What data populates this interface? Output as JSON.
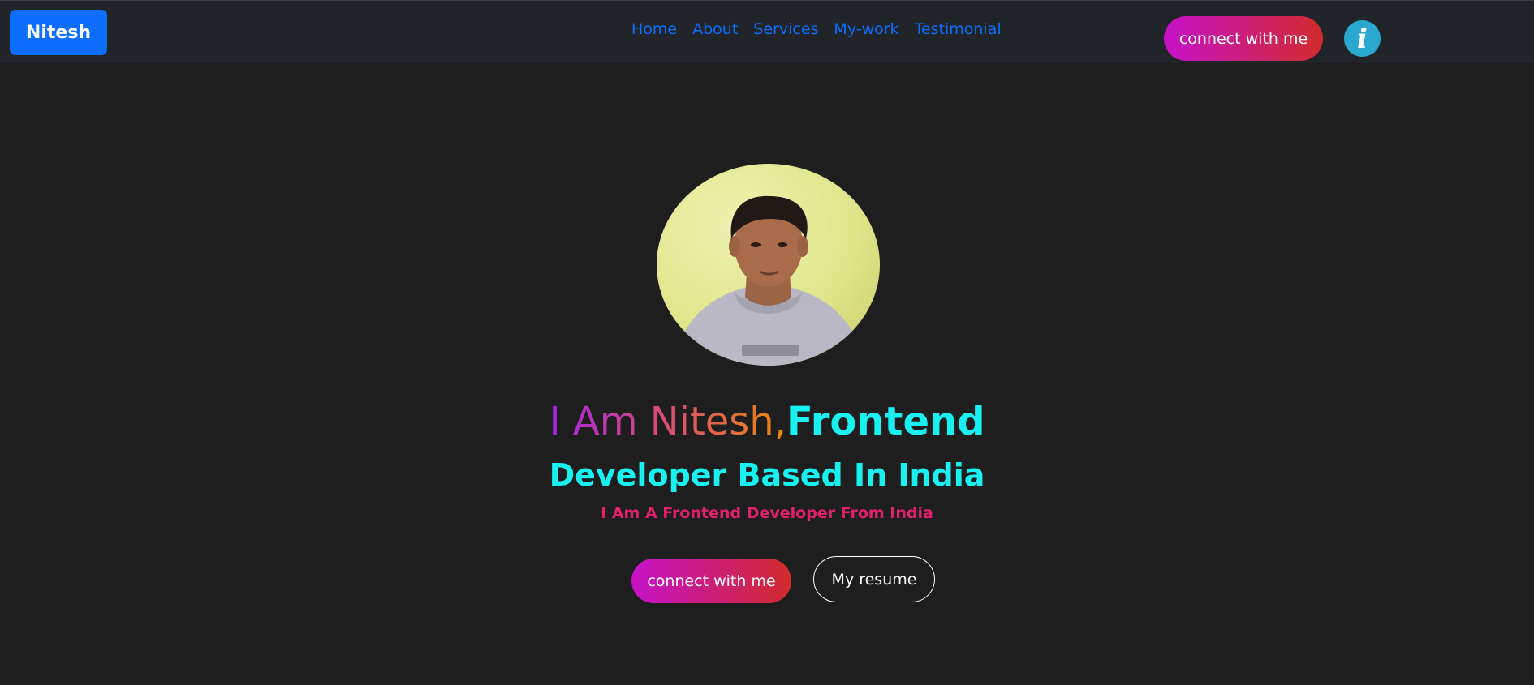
{
  "nav": {
    "brand": "Nitesh",
    "links": [
      "Home",
      "About",
      "Services",
      "My-work",
      "Testimonial"
    ],
    "connect_label": "connect with me",
    "info_icon": "info-icon"
  },
  "hero": {
    "headline_gradient": "I Am Nitesh,",
    "headline_highlight": "Frontend",
    "subline": "Developer Based In India",
    "tagline": "I Am A Frontend Developer From India",
    "connect_label": "connect with me",
    "resume_label": "My resume",
    "avatar_icon": "profile-photo"
  },
  "colors": {
    "page_background": "#1e1e1f",
    "navbar_background": "#212529",
    "brand_background": "#0d6efd",
    "nav_link": "#0d6efd",
    "button_gradient_start": "#c512c8",
    "button_gradient_end": "#d12b2b",
    "info_icon_background": "#2aa8cf",
    "highlight_cyan": "#19f0f0",
    "tagline_pink": "#e0206a"
  }
}
